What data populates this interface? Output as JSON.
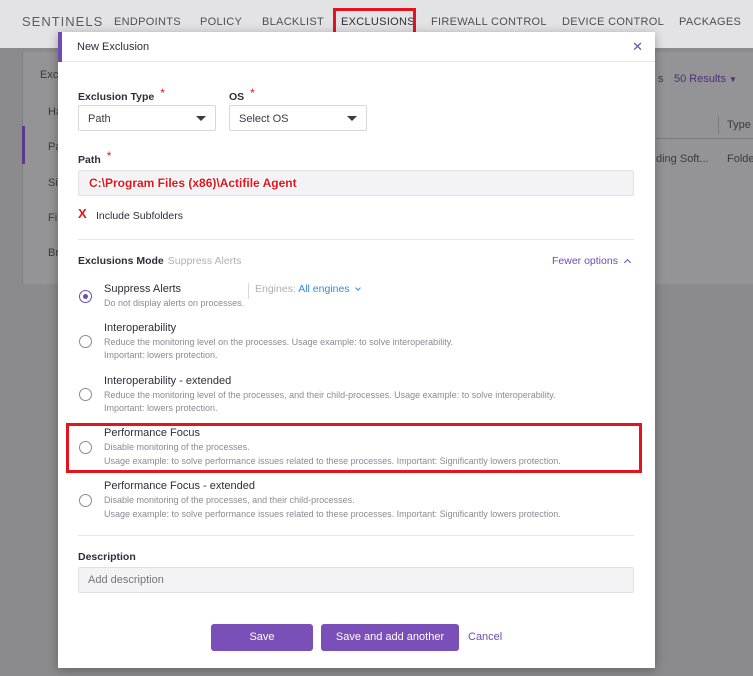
{
  "nav": {
    "brand": "SENTINELS",
    "items": [
      "ENDPOINTS",
      "POLICY",
      "BLACKLIST",
      "EXCLUSIONS",
      "FIREWALL CONTROL",
      "DEVICE CONTROL",
      "PACKAGES"
    ],
    "active": "EXCLUSIONS"
  },
  "background": {
    "header_fragment": "Excl",
    "side_items": [
      "Ha",
      "Pa",
      "Si",
      "Fi",
      "Br"
    ],
    "results": "50 Results",
    "results_prefix_fragment": "s",
    "column_type": "Type",
    "row_fragment_1": "ding Soft...",
    "row_fragment_2": "Folde"
  },
  "modal": {
    "title": "New Exclusion",
    "exclusion_type": {
      "label": "Exclusion Type",
      "value": "Path"
    },
    "os": {
      "label": "OS",
      "value": "Select OS"
    },
    "path": {
      "label": "Path",
      "value": "C:\\Program Files (x86)\\Actifile Agent"
    },
    "include_subfolders": {
      "mark": "X",
      "label": "Include Subfolders"
    },
    "mode": {
      "label": "Exclusions Mode",
      "current": "Suppress Alerts",
      "fewer_options": "Fewer options",
      "engines_label": "Engines:",
      "engines_value": "All engines",
      "options": [
        {
          "title": "Suppress Alerts",
          "desc": [
            "Do not display alerts on processes."
          ],
          "selected": true
        },
        {
          "title": "Interoperability",
          "desc": [
            "Reduce the monitoring level on the processes. Usage example: to solve interoperability.",
            "Important: lowers protection."
          ],
          "selected": false
        },
        {
          "title": "Interoperability - extended",
          "desc": [
            "Reduce the monitoring level of the processes, and their child-processes. Usage example: to solve interoperability.",
            "Important: lowers protection."
          ],
          "selected": false
        },
        {
          "title": "Performance Focus",
          "desc": [
            "Disable monitoring of the processes.",
            "Usage example: to solve performance issues related to these processes. Important: Significantly lowers protection."
          ],
          "selected": false
        },
        {
          "title": "Performance Focus - extended",
          "desc": [
            "Disable monitoring of the processes, and their child-processes.",
            "Usage example: to solve performance issues related to these processes. Important: Significantly lowers protection."
          ],
          "selected": false
        }
      ]
    },
    "description": {
      "label": "Description",
      "placeholder": "Add description"
    },
    "buttons": {
      "save": "Save",
      "save_add": "Save and add another",
      "cancel": "Cancel"
    }
  },
  "colors": {
    "accent": "#6f4bb3",
    "annotation_red": "#e4141c",
    "link_blue": "#2f8be6"
  }
}
